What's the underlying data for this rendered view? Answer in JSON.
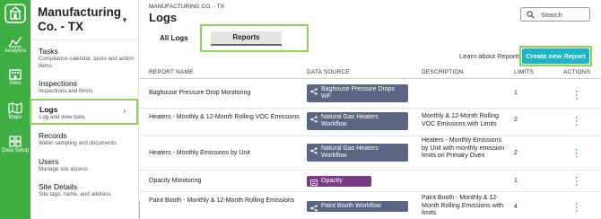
{
  "rail": {
    "items": [
      {
        "label": "Analytics",
        "icon": "chart-icon"
      },
      {
        "label": "Sites",
        "icon": "building-icon"
      },
      {
        "label": "Maps",
        "icon": "map-icon"
      },
      {
        "label": "Data Setup",
        "icon": "grid-icon"
      }
    ]
  },
  "sidebar": {
    "company": "Manufacturing Co. - TX",
    "items": [
      {
        "title": "Tasks",
        "subtitle": "Compliance calendar, tasks and action items"
      },
      {
        "title": "Inspections",
        "subtitle": "Inspections and forms"
      },
      {
        "title": "Logs",
        "subtitle": "Log and view data",
        "active": true
      },
      {
        "title": "Records",
        "subtitle": "Water sampling and documents"
      },
      {
        "title": "Users",
        "subtitle": "Manage site access"
      },
      {
        "title": "Site Details",
        "subtitle": "Site tags, name, and address"
      }
    ]
  },
  "header": {
    "breadcrumb": "MANUFACTURING CO. - TX",
    "title": "Logs",
    "search_placeholder": "Search"
  },
  "tabs": [
    {
      "label": "All Logs"
    },
    {
      "label": "Reports",
      "active": true
    }
  ],
  "actions": {
    "learn_link": "Learn about Reports",
    "create_button": "Create new Report"
  },
  "table": {
    "columns": [
      "REPORT NAME",
      "DATA SOURCE",
      "DESCRIPTION",
      "LIMITS",
      "ACTIONS"
    ],
    "rows": [
      {
        "name": "Baghouse Pressure Drop Monitoring",
        "source": "Baghouse Pressure Drops WF",
        "source_style": "workflow",
        "description": "",
        "limits": "1"
      },
      {
        "name": "Heaters - Monthly & 12-Month Rolling VOC Emissions",
        "source": "Natural Gas Heaters Workflow",
        "source_style": "workflow",
        "description": "Monthly & 12-Month Rolling VOC Emissions with Limits",
        "limits": "2"
      },
      {
        "name": "Heaters - Monthly Emissions by Unit",
        "source": "Natural Gas Heaters Workflow",
        "source_style": "workflow",
        "description": "Heaters - Monthly Emissions by Unit with monthly emission limits on Primary Oven",
        "limits": "2"
      },
      {
        "name": "Opacity Monitoring",
        "source": "Opacity",
        "source_style": "form",
        "description": "",
        "limits": "1"
      },
      {
        "name": "Paint Booth - Monthly & 12-Month Rolling Emissions",
        "source": "Paint Booth Workflow",
        "source_style": "workflow",
        "description": "Paint Booth - Monthly & 12-Month Rolling Emissions with limits",
        "limits": "4"
      }
    ]
  },
  "colors": {
    "rail": "#3fae45",
    "highlight": "#8cd35a",
    "primary_button": "#1eb5c9",
    "workflow_chip": "#5b6682",
    "form_chip": "#7a3a86",
    "action_dots": "#1a73e8"
  }
}
